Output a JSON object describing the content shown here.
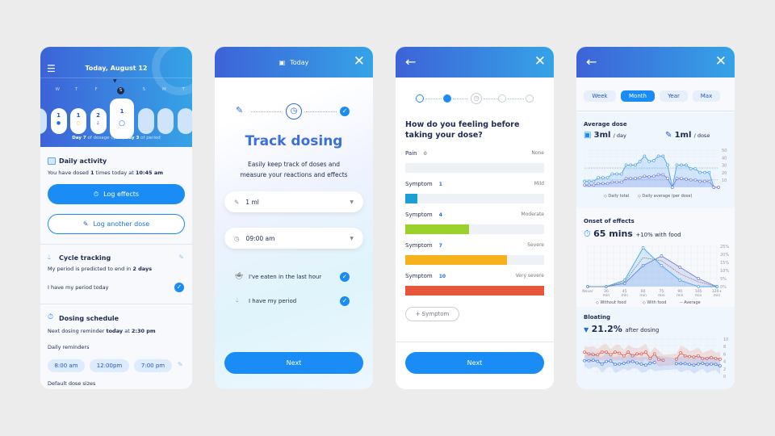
{
  "colors": {
    "accent": "#1a8cf5",
    "gradient_start": "#3d63d8",
    "gradient_end": "#35a3e6",
    "red": "#e8553d",
    "orange": "#f5b21c",
    "green": "#9ad12d",
    "teal": "#1a9fd6"
  },
  "screen1": {
    "title": "Today, August 12",
    "weekdays": [
      "T",
      "W",
      "T",
      "F",
      "S",
      "S",
      "M",
      "T",
      "W"
    ],
    "day_pills": [
      {
        "count": "",
        "icon": ""
      },
      {
        "count": "1",
        "icon": "dot"
      },
      {
        "count": "1",
        "icon": "drop-orange"
      },
      {
        "count": "2",
        "icon": "drop"
      },
      {
        "count": "1",
        "icon": "drop-outline"
      },
      {
        "count": "",
        "icon": ""
      },
      {
        "count": "",
        "icon": ""
      },
      {
        "count": "",
        "icon": ""
      },
      {
        "count": "",
        "icon": ""
      }
    ],
    "cycle_day_label": "Day 7",
    "cycle_text": "of dosage cycle,",
    "period_day_label": "Day 3",
    "period_text": "of period",
    "daily_activity": {
      "title": "Daily activity",
      "text_a": "You have dosed",
      "count": "1",
      "text_b": "times today at",
      "time": "10:45 am"
    },
    "log_effects": "Log effects",
    "log_dose": "Log another dose",
    "cycle": {
      "title": "Cycle tracking",
      "text": "My period is predicted to end in",
      "days": "2 days",
      "period_today": "I have my period today"
    },
    "schedule": {
      "title": "Dosing schedule",
      "text": "Next dosing reminder",
      "when": "today",
      "at": "at",
      "time": "2:30 pm",
      "reminders_label": "Daily reminders",
      "reminders": [
        "8:00 am",
        "12:00pm",
        "7:00 pm"
      ],
      "dose_sizes": "Default dose sizes"
    }
  },
  "screen2": {
    "header": "Today",
    "title": "Track dosing",
    "subtitle_1": "Easily keep track of doses and",
    "subtitle_2": "measure your reactions and effects",
    "dose": "1 ml",
    "time": "09:00 am",
    "eaten": "I've eaten in the last hour",
    "period": "I have my period",
    "next": "Next"
  },
  "screen3": {
    "question": "How do you feeling before taking your dose?",
    "symptoms": [
      {
        "name": "Pain",
        "value": "0",
        "level": "None",
        "fraction": 0,
        "color": "#eef1f5"
      },
      {
        "name": "Symptom",
        "value": "1",
        "level": "Mild",
        "fraction": 0.09,
        "color": "#1a9fd6"
      },
      {
        "name": "Symptom",
        "value": "4",
        "level": "Moderate",
        "fraction": 0.46,
        "color": "#9ad12d"
      },
      {
        "name": "Symptom",
        "value": "7",
        "level": "Severe",
        "fraction": 0.73,
        "color": "#f5b21c"
      },
      {
        "name": "Symptom",
        "value": "10",
        "level": "Very severe",
        "fraction": 1,
        "color": "#e8553d"
      }
    ],
    "add_symptom": "+ Symptom",
    "next": "Next",
    "steps_done": 2,
    "steps_total": 5
  },
  "screen4": {
    "tabs": [
      "Week",
      "Month",
      "Year",
      "Max"
    ],
    "active_tab": "Month",
    "avg": {
      "title": "Average dose",
      "day_value": "3ml",
      "day_unit": "/ day",
      "dose_value": "1ml",
      "dose_unit": "/ dose"
    },
    "onset": {
      "title": "Onset of effects",
      "value": "65 mins",
      "note": "+10% with food"
    },
    "bloating": {
      "title": "Bloating",
      "value": "21.2%",
      "note": "after dosing",
      "trend": "down"
    }
  },
  "chart_data": [
    {
      "type": "area",
      "ylim": [
        0,
        50
      ],
      "yticks": [
        "10",
        "20",
        "30",
        "40",
        "50"
      ],
      "reference_lines": [
        26,
        10
      ],
      "series": [
        {
          "name": "Daily total",
          "values": [
            8,
            8,
            8,
            13,
            13,
            13,
            18,
            18,
            18,
            30,
            30,
            30,
            35,
            42,
            35,
            36,
            42,
            42,
            30,
            0,
            30,
            30,
            30,
            25,
            25,
            20,
            20,
            20,
            0,
            0
          ]
        },
        {
          "name": "Daily average (per dose)",
          "values": [
            3,
            3,
            3,
            5,
            5,
            5,
            7,
            7,
            7,
            12,
            12,
            12,
            13,
            15,
            14,
            15,
            17,
            17,
            12,
            0,
            12,
            12,
            11,
            10,
            10,
            8,
            8,
            8,
            0,
            0
          ]
        }
      ]
    },
    {
      "type": "area",
      "categories": [
        "Never",
        "30 min",
        "45 min",
        "60 min",
        "75 min",
        "90 min",
        "105 min",
        "120+ min"
      ],
      "ylim": [
        0,
        25
      ],
      "yticks": [
        "0%",
        "5%",
        "10%",
        "15%",
        "20%",
        "25%"
      ],
      "series": [
        {
          "name": "Without food",
          "values": [
            0,
            0,
            2,
            13,
            19,
            12,
            5,
            0
          ]
        },
        {
          "name": "With food",
          "values": [
            0,
            0,
            4,
            24,
            13,
            4,
            0,
            0
          ]
        },
        {
          "name": "Average",
          "values": [
            0,
            0,
            3,
            18,
            16,
            8,
            3,
            0
          ]
        }
      ]
    },
    {
      "type": "line",
      "ylim": [
        0,
        10
      ],
      "yticks": [
        "0",
        "2",
        "4",
        "6",
        "8",
        "10"
      ],
      "series": [
        {
          "values": [
            6.5,
            6,
            5.8,
            5.8,
            6.5,
            6.5,
            5.8,
            6.5,
            6.2,
            5.5,
            6.5,
            5.5,
            6,
            6,
            6.5,
            4.8,
            6,
            4.5,
            4.3,
            null,
            null,
            4.6,
            6.3,
            5.5,
            5.3,
            5.2,
            5.5,
            4.8,
            4.8,
            5,
            4.8,
            4.6
          ]
        },
        {
          "values": [
            4.2,
            4.2,
            4.3,
            4,
            3.3,
            4,
            4.1,
            3.2,
            3.3,
            3.5,
            3.8,
            4,
            3.6,
            3.3,
            3,
            3.5,
            3.7,
            null,
            null,
            null,
            null,
            3.4,
            3.4,
            3.4,
            3.2,
            3,
            3.3,
            3.5,
            3.2,
            3.3,
            3.2,
            2.8
          ]
        }
      ]
    }
  ]
}
